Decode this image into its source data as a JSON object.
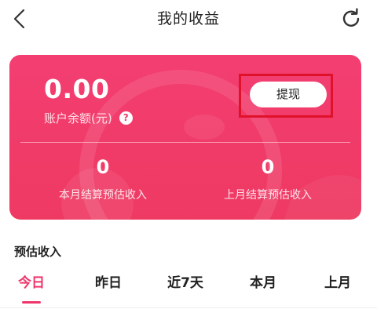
{
  "header": {
    "title": "我的收益",
    "back_icon": "chevron-left-icon",
    "refresh_icon": "refresh-icon"
  },
  "balance": {
    "value": "0.00",
    "label": "账户余额(元)",
    "help_icon_text": "?",
    "withdraw_label": "提现"
  },
  "stats": [
    {
      "value": "0",
      "label": "本月结算预估收入"
    },
    {
      "value": "0",
      "label": "上月结算预估收入"
    }
  ],
  "estimate": {
    "title": "预估收入",
    "tabs": [
      {
        "label": "今日",
        "active": true
      },
      {
        "label": "昨日",
        "active": false
      },
      {
        "label": "近7天",
        "active": false
      },
      {
        "label": "本月",
        "active": false
      },
      {
        "label": "上月",
        "active": false
      }
    ]
  },
  "colors": {
    "accent": "#f0356b",
    "card": "#f03b68",
    "highlight": "#e0112b"
  }
}
